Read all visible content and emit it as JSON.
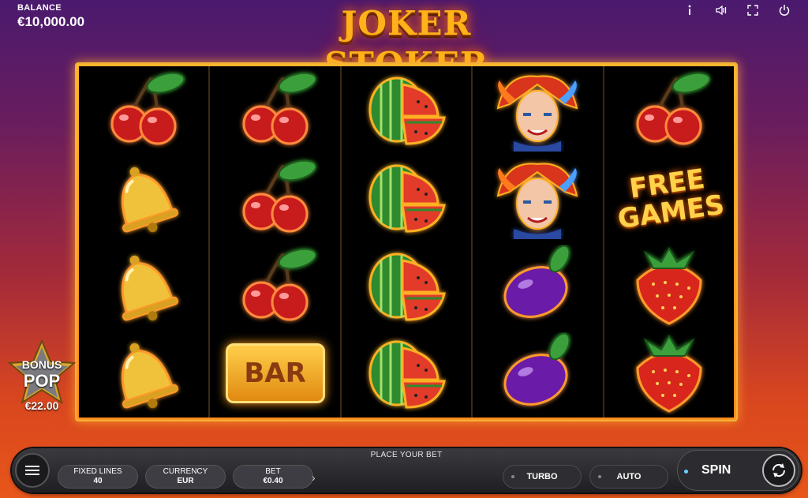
{
  "balance": {
    "label": "BALANCE",
    "value": "€10,000.00"
  },
  "logo": {
    "text": "JOKER STOKER"
  },
  "top_icons": [
    "info-icon",
    "sound-icon",
    "fullscreen-icon",
    "power-icon"
  ],
  "reels": [
    [
      "cherry",
      "bell",
      "bell",
      "bell"
    ],
    [
      "cherry",
      "cherry",
      "cherry",
      "bar"
    ],
    [
      "watermelon",
      "watermelon",
      "watermelon",
      "watermelon"
    ],
    [
      "joker",
      "joker",
      "plum",
      "plum"
    ],
    [
      "cherry",
      "free-games",
      "strawberry",
      "strawberry"
    ]
  ],
  "symbols": {
    "bar_text": "BAR",
    "free_games_line1": "FREE",
    "free_games_line2": "GAMES"
  },
  "bonus_pop": {
    "line1": "BONUS",
    "line2": "POP",
    "value": "€22.00"
  },
  "bottom": {
    "place_bet": "PLACE YOUR BET",
    "fixed_lines": {
      "label": "FIXED LINES",
      "value": "40"
    },
    "currency": {
      "label": "CURRENCY",
      "value": "EUR"
    },
    "bet": {
      "label": "BET",
      "value": "€0.40"
    },
    "turbo_label": "TURBO",
    "auto_label": "AUTO",
    "spin_label": "SPIN"
  },
  "colors": {
    "frame": "#f3b235",
    "bg_top": "#4a1a6e",
    "bg_bottom": "#e8561a",
    "accent_spin_dot": "#6ad4ff"
  }
}
